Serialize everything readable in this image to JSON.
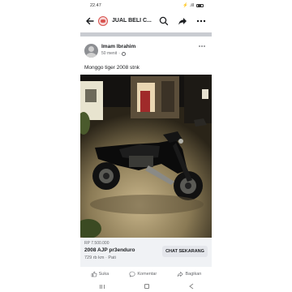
{
  "status_bar": {
    "time": "22.47",
    "indicators": "⚡ .ill"
  },
  "app_bar": {
    "title": "JUAL BELI C...",
    "icons": [
      "back-arrow-icon",
      "group-icon",
      "search-icon",
      "share-icon",
      "more-icon"
    ]
  },
  "post": {
    "author": "Imam Ibrahim",
    "time": "50 menit",
    "privacy_icon": "globe-icon",
    "text": "Monggo tiger 2008 stnk"
  },
  "listing": {
    "price": "RP 7.500.000",
    "title": "2008 AJP pr3enduro",
    "details": "729 rb km · Pati",
    "chat_button": "CHAT SEKARANG"
  },
  "actions": {
    "like": "Suka",
    "comment": "Komentar",
    "share": "Bagikan"
  },
  "colors": {
    "text_primary": "#1c1e21",
    "text_secondary": "#65676b",
    "listing_bg": "#f0f2f5",
    "button_bg": "#e4e6eb",
    "separator": "#c9ccd1"
  }
}
